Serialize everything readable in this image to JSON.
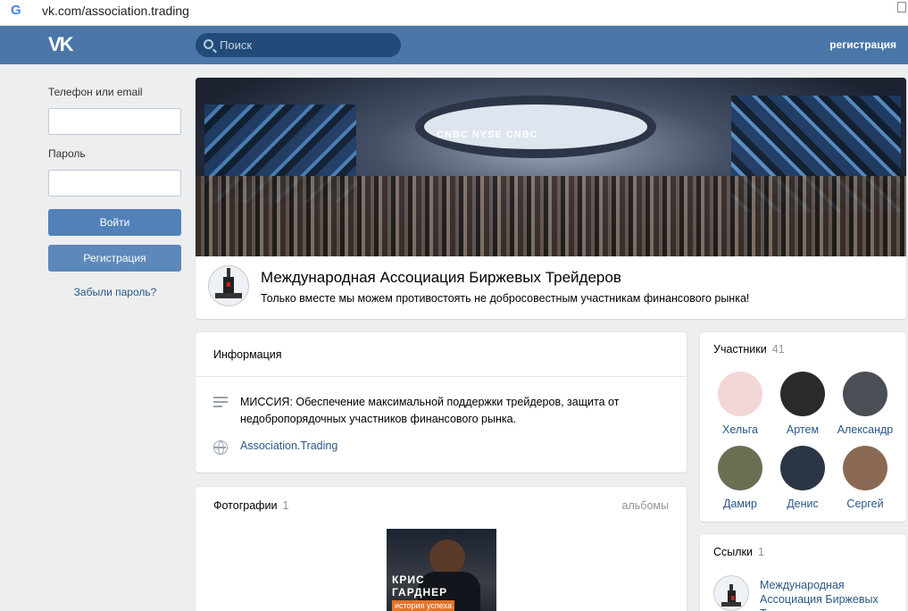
{
  "browser": {
    "url": "vk.com/association.trading"
  },
  "header": {
    "search_placeholder": "Поиск",
    "register_link": "регистрация"
  },
  "login": {
    "phone_label": "Телефон или email",
    "password_label": "Пароль",
    "login_button": "Войти",
    "register_button": "Регистрация",
    "forgot_link": "Забыли пароль?"
  },
  "group": {
    "name": "Международная Ассоциация Биржевых Трейдеров",
    "status": "Только вместе мы можем противостоять не добросовестным участникам финансового рынка!",
    "cover_caption": "CNBC   NYSE   CNBC"
  },
  "info": {
    "title": "Информация",
    "mission": "МИССИЯ: Обеспечение максимальной поддержки трейдеров, защита от недобропорядочных участников финансового рынка.",
    "site_link": "Association.Trading"
  },
  "photos": {
    "title": "Фотографии",
    "count": "1",
    "albums_link": "альбомы",
    "thumb_title_line1": "КРИС",
    "thumb_title_line2": "ГАРДНЕР",
    "thumb_subtitle": "история успеха"
  },
  "members": {
    "title": "Участники",
    "count": "41",
    "list": [
      {
        "name": "Хельга",
        "color": "#f3d6d6"
      },
      {
        "name": "Артем",
        "color": "#2a2a2a"
      },
      {
        "name": "Александр",
        "color": "#4a4f55"
      },
      {
        "name": "Дамир",
        "color": "#6a6f52"
      },
      {
        "name": "Денис",
        "color": "#2b3645"
      },
      {
        "name": "Сергей",
        "color": "#8a6a55"
      }
    ]
  },
  "links": {
    "title": "Ссылки",
    "count": "1",
    "item_title": "Международная Ассоциация Биржевых Тре"
  },
  "colors": {
    "vk_blue": "#4a76a8",
    "button_blue": "#5181b8",
    "link_blue": "#2a5885"
  }
}
